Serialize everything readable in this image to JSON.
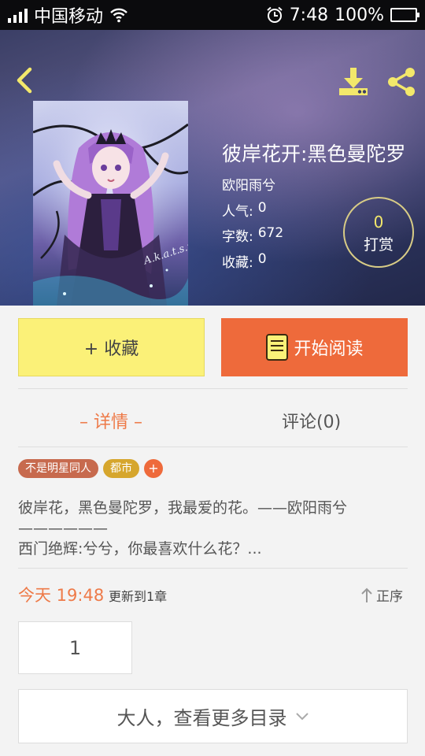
{
  "status_bar": {
    "carrier": "中国移动",
    "time": "7:48",
    "battery": "100%",
    "icons": [
      "signal-icon",
      "wifi-icon",
      "alarm-icon",
      "battery-icon"
    ]
  },
  "header": {
    "icons": [
      "back-arrow-icon",
      "download-icon",
      "share-icon"
    ],
    "accent_color": "#f3e86b"
  },
  "book": {
    "title": "彼岸花开:黑色曼陀罗",
    "author": "欧阳雨兮",
    "popularity_label": "人气:",
    "popularity_value": "0",
    "words_label": "字数:",
    "words_value": "672",
    "favorites_label": "收藏:",
    "favorites_value": "0",
    "cover_signature": "A.k.a.t.s.u.ki"
  },
  "tip": {
    "count": "0",
    "label": "打赏"
  },
  "actions": {
    "favorite_label": "+ 收藏",
    "read_label": "开始阅读",
    "favorite_color": "#fbf178",
    "read_color": "#ee6a3b"
  },
  "tabs": {
    "detail": "– 详情 –",
    "comment": "评论(0)"
  },
  "tags": [
    "不是明星同人",
    "都市"
  ],
  "tag_add": "+",
  "description": {
    "line1": "彼岸花，黑色曼陀罗，我最爱的花。——欧阳雨兮",
    "line2": "——————",
    "line3": "西门绝辉:兮兮，你最喜欢什么花？..."
  },
  "update": {
    "date": "今天 19:48",
    "text": "更新到1章",
    "sort_label": "正序"
  },
  "chapter_number": "1",
  "more_toc_label": "大人，查看更多目录"
}
